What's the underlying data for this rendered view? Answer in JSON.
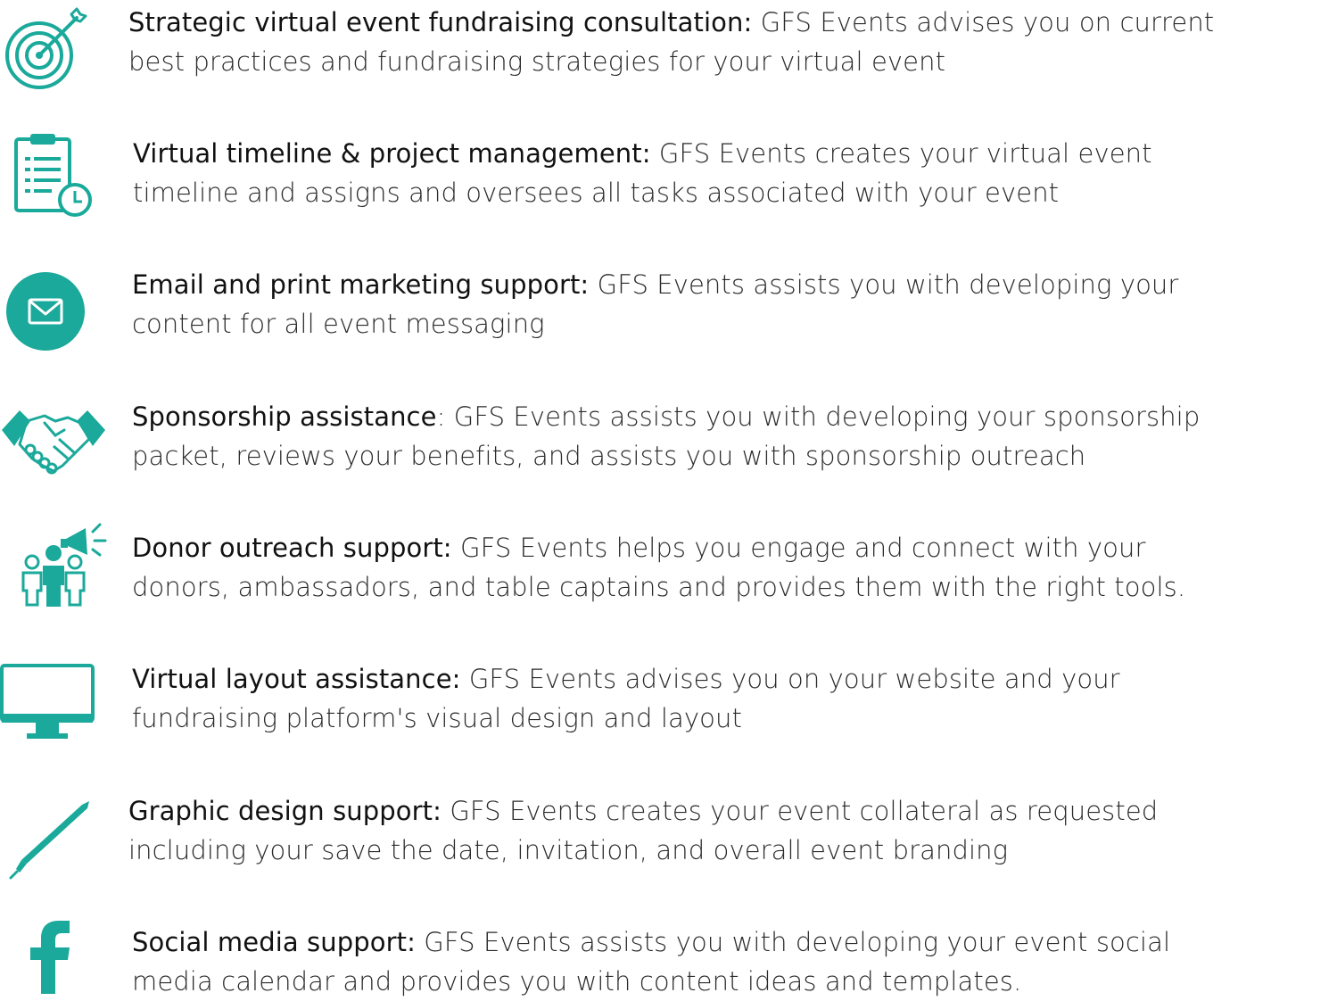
{
  "accent_color": "#1aa99a",
  "items": [
    {
      "icon": "target-icon",
      "lead": "Strategic virtual event fundraising consultation:",
      "line1": " GFS Events advises you on current",
      "line2": "best practices and fundraising strategies for your virtual event"
    },
    {
      "icon": "clipboard-clock-icon",
      "lead": "Virtual timeline & project management:",
      "line1": " GFS Events creates your virtual event",
      "line2": "timeline and assigns and oversees all tasks associated with your event"
    },
    {
      "icon": "envelope-icon",
      "lead": "Email and print marketing support:",
      "line1": " GFS Events assists you with developing your",
      "line2": "content for all event messaging"
    },
    {
      "icon": "handshake-icon",
      "lead": "Sponsorship assistance",
      "line1": ": GFS Events assists you with developing your sponsorship",
      "line2": "packet, reviews your benefits, and assists you with sponsorship outreach"
    },
    {
      "icon": "megaphone-people-icon",
      "lead": "Donor outreach support:",
      "line1": " GFS Events helps you engage and connect with your",
      "line2": "donors, ambassadors, and table captains and provides them with the right tools."
    },
    {
      "icon": "monitor-icon",
      "lead": "Virtual layout assistance:",
      "line1": " GFS Events advises you on your website and your",
      "line2": "fundraising platform's visual design and layout"
    },
    {
      "icon": "pen-nib-icon",
      "lead": "Graphic design support:",
      "line1": " GFS Events creates your event collateral as requested",
      "line2": "including your save the date, invitation, and overall event branding"
    },
    {
      "icon": "facebook-icon",
      "lead": "Social media support:",
      "line1": " GFS Events assists you with developing your event social",
      "line2": "media calendar and provides you with content ideas and templates."
    }
  ]
}
